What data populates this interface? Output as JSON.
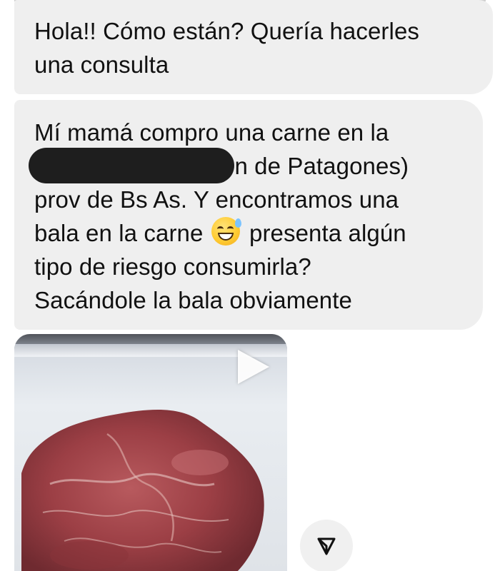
{
  "messages": [
    {
      "lines": [
        "Hola!! Cómo están? Quería hacerles",
        "una consulta"
      ]
    },
    {
      "line1": "Mí mamá compro una carne en la",
      "line2_visible": "en de Patagones)",
      "line3": "prov de Bs As. Y encontramos una",
      "line4_before_emoji": "bala en la carne",
      "line4_after_emoji": "presenta algún",
      "line5": "tipo de riesgo consumirla?",
      "line6": "Sacándole la bala obviamente"
    }
  ],
  "attachment": {
    "type": "video",
    "play_icon": "play-icon"
  },
  "icons": {
    "emoji": "sweat-smile-emoji-icon",
    "share": "send-icon"
  },
  "colors": {
    "bubble_bg": "#efefef",
    "text": "#111111",
    "redaction": "#1e1e1e"
  }
}
